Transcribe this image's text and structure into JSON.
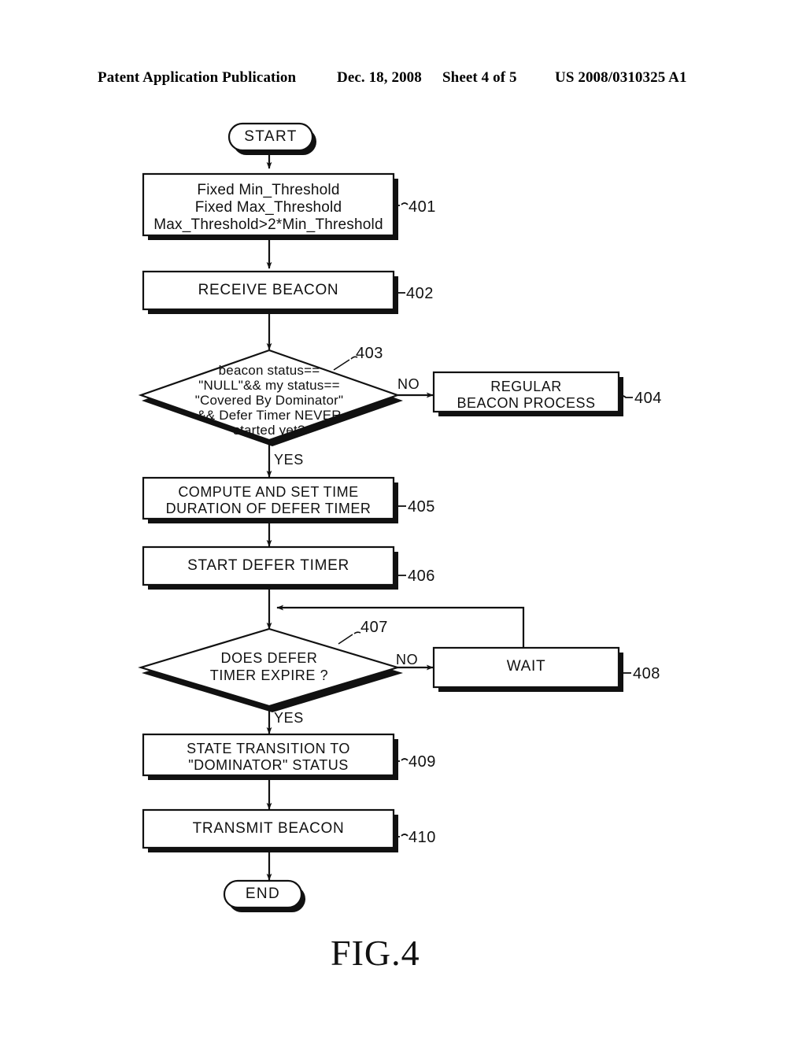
{
  "header": {
    "publication": "Patent Application Publication",
    "date": "Dec. 18, 2008",
    "sheet": "Sheet 4 of 5",
    "patent_number": "US 2008/0310325 A1"
  },
  "figure": {
    "caption": "FIG.4",
    "nodes": {
      "start": {
        "label": "START",
        "shape": "terminal"
      },
      "n401": {
        "label": "Fixed Min_Threshold\nFixed Max_Threshold\nMax_Threshold>2*Min_Threshold",
        "ref": "401",
        "shape": "process"
      },
      "n402": {
        "label": "RECEIVE BEACON",
        "ref": "402",
        "shape": "process"
      },
      "n403": {
        "label": "beacon status==\n\"NULL\"&& my status==\n\"Covered By Dominator\"\n&& Defer Timer NEVER\nstarted yet?",
        "ref": "403",
        "shape": "decision"
      },
      "n404": {
        "label": "REGULAR\nBEACON PROCESS",
        "ref": "404",
        "shape": "process"
      },
      "n405": {
        "label": "COMPUTE AND SET TIME\nDURATION OF DEFER TIMER",
        "ref": "405",
        "shape": "process"
      },
      "n406": {
        "label": "START DEFER TIMER",
        "ref": "406",
        "shape": "process"
      },
      "n407": {
        "label": "DOES DEFER\nTIMER EXPIRE ?",
        "ref": "407",
        "shape": "decision"
      },
      "n408": {
        "label": "WAIT",
        "ref": "408",
        "shape": "process"
      },
      "n409": {
        "label": "STATE TRANSITION TO\n\"DOMINATOR\" STATUS",
        "ref": "409",
        "shape": "process"
      },
      "n410": {
        "label": "TRANSMIT BEACON",
        "ref": "410",
        "shape": "process"
      },
      "end": {
        "label": "END",
        "shape": "terminal"
      }
    },
    "edge_labels": {
      "no_403": "NO",
      "yes_403": "YES",
      "no_407": "NO",
      "yes_407": "YES"
    },
    "colors": {
      "ink": "#111111",
      "paper": "#ffffff",
      "shadow": "#111111"
    }
  }
}
